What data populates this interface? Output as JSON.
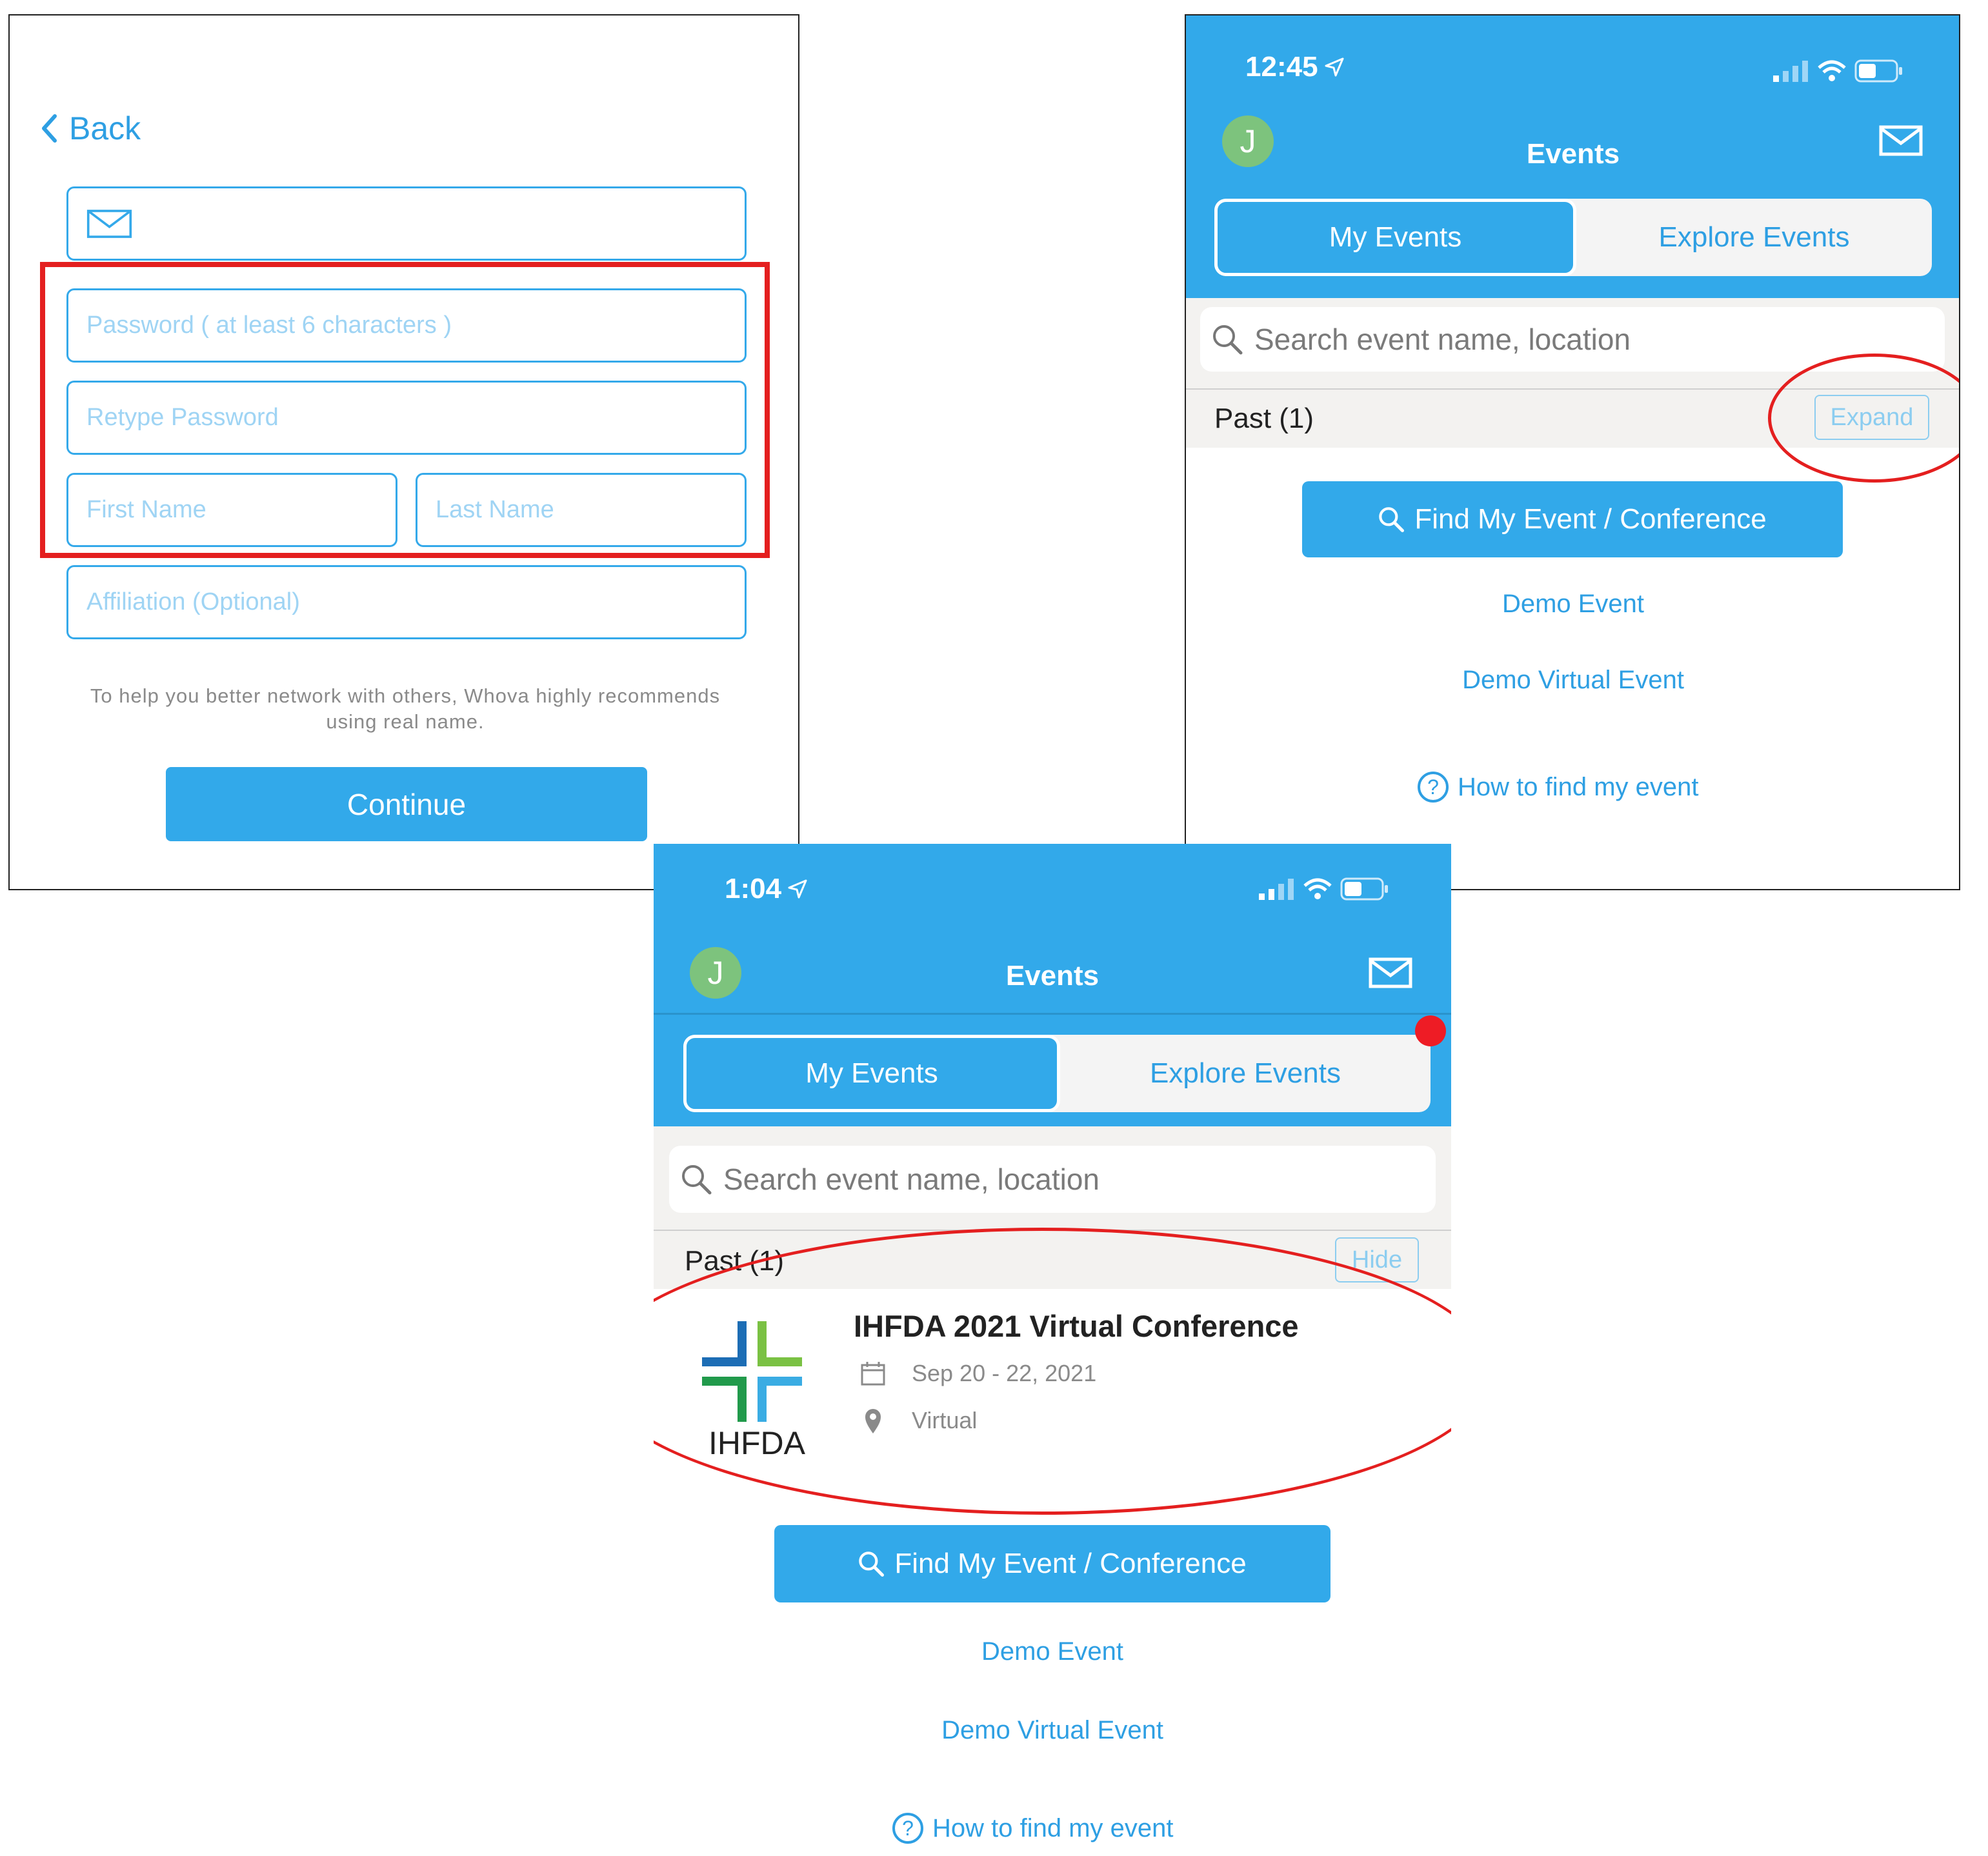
{
  "signup": {
    "back_label": "Back",
    "email_placeholder": "",
    "password_placeholder": "Password ( at least 6 characters )",
    "retype_placeholder": "Retype Password",
    "first_name_placeholder": "First Name",
    "last_name_placeholder": "Last Name",
    "affiliation_placeholder": "Affiliation (Optional)",
    "helper_text": "To help you better network with others, Whova highly recommends using real name.",
    "continue_label": "Continue"
  },
  "events_collapsed": {
    "time": "12:45",
    "avatar_initial": "J",
    "title": "Events",
    "tabs": [
      "My Events",
      "Explore Events"
    ],
    "search_placeholder": "Search event name, location",
    "section_label": "Past (1)",
    "toggle_label": "Expand",
    "find_label": "Find My Event / Conference",
    "links": [
      "Demo Event",
      "Demo Virtual Event"
    ],
    "help_label": "How to find my event"
  },
  "events_expanded": {
    "time": "1:04",
    "avatar_initial": "J",
    "title": "Events",
    "tabs": [
      "My Events",
      "Explore Events"
    ],
    "search_placeholder": "Search event name, location",
    "section_label": "Past (1)",
    "toggle_label": "Hide",
    "event": {
      "title": "IHFDA 2021 Virtual Conference",
      "dates": "Sep 20 - 22, 2021",
      "location": "Virtual",
      "logo_text": "IHFDA"
    },
    "find_label": "Find My Event / Conference",
    "links": [
      "Demo Event",
      "Demo Virtual Event"
    ],
    "help_label": "How to find my event"
  },
  "colors": {
    "brand_blue": "#32a9ea",
    "annotation_red": "#e41f1f",
    "avatar_green": "#7dc37d",
    "notification_red": "#ee1c25"
  },
  "icons": [
    "chevron-left-icon",
    "mail-icon",
    "search-icon",
    "location-arrow-icon",
    "signal-icon",
    "wifi-icon",
    "battery-icon",
    "calendar-icon",
    "map-pin-icon",
    "question-circle-icon"
  ]
}
